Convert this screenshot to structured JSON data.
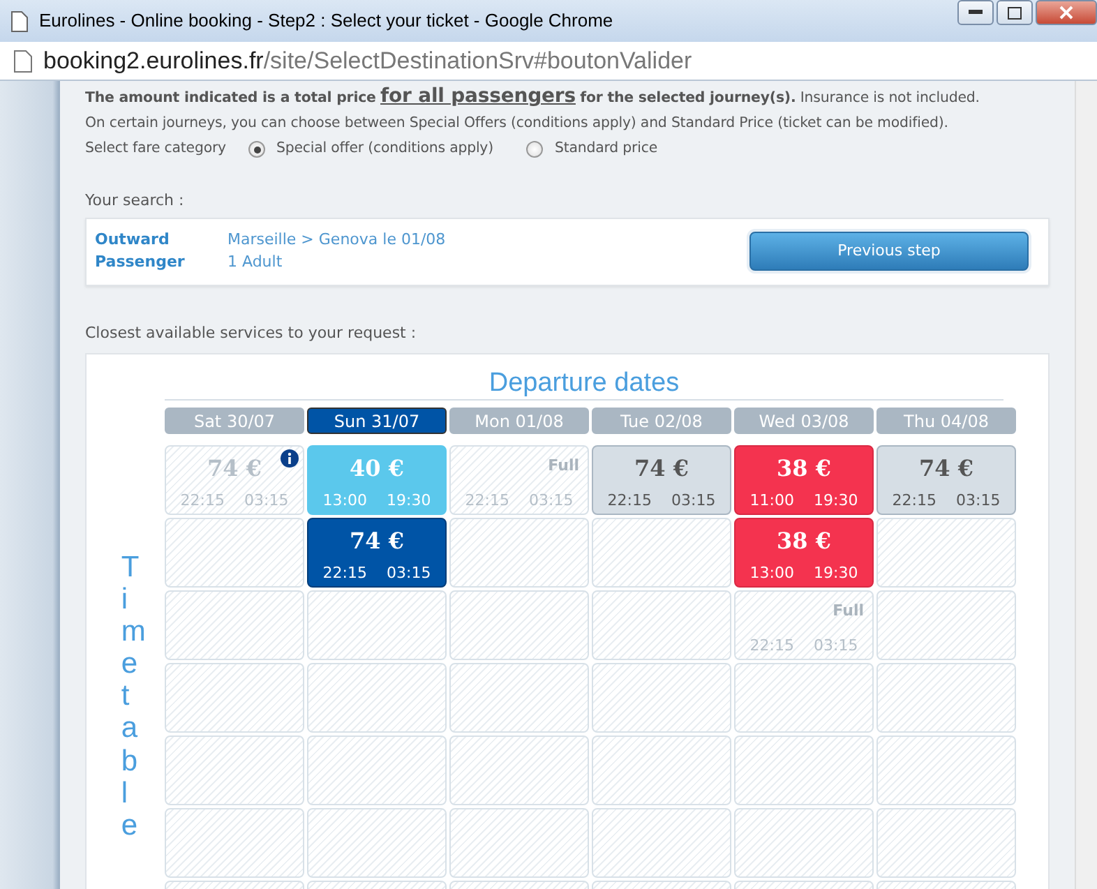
{
  "window": {
    "title": "Eurolines - Online booking - Step2 : Select your ticket - Google Chrome"
  },
  "address_bar": {
    "host": "booking2.eurolines.fr",
    "path": "/site/SelectDestinationSrv#boutonValider"
  },
  "notice": {
    "line_1": "**The amount indicated is a total price** for all passengers **for the selected journey(s).** Insurance is not included.",
    "line_2": "On certain journeys, you can choose between Special Offers (conditions apply) and Standard Price (ticket can be modified)."
  },
  "fare_category": {
    "label": "Select fare category",
    "options": [
      {
        "label": "Special offer (conditions apply)",
        "selected": true
      },
      {
        "label": "Standard price",
        "selected": false
      }
    ]
  },
  "search": {
    "heading": "Your search :",
    "rows": [
      {
        "label": "Outward",
        "value": "Marseille > Genova le 01/08"
      },
      {
        "label": "Passenger",
        "value": "1 Adult"
      }
    ],
    "button": "Previous step"
  },
  "results": {
    "heading": "Closest available services to your request :",
    "title": "Departure dates",
    "side_label": "Timetable",
    "days": [
      {
        "label": "Sat 30/07",
        "selected": false
      },
      {
        "label": "Sun 31/07",
        "selected": true
      },
      {
        "label": "Mon 01/08",
        "selected": false
      },
      {
        "label": "Tue 02/08",
        "selected": false
      },
      {
        "label": "Wed 03/08",
        "selected": false
      },
      {
        "label": "Thu 04/08",
        "selected": false
      }
    ],
    "rows": [
      [
        {
          "kind": "past",
          "price": "74 €",
          "depart": "22:15",
          "arrive": "03:15",
          "info": true
        },
        {
          "kind": "offer",
          "price": "40 €",
          "depart": "13:00",
          "arrive": "19:30"
        },
        {
          "kind": "full",
          "status": "Full",
          "depart": "22:15",
          "arrive": "03:15"
        },
        {
          "kind": "standard",
          "price": "74 €",
          "depart": "22:15",
          "arrive": "03:15"
        },
        {
          "kind": "cheap",
          "price": "38 €",
          "depart": "11:00",
          "arrive": "19:30"
        },
        {
          "kind": "standard",
          "price": "74 €",
          "depart": "22:15",
          "arrive": "03:15"
        }
      ],
      [
        {
          "kind": "empty"
        },
        {
          "kind": "selected",
          "price": "74 €",
          "depart": "22:15",
          "arrive": "03:15"
        },
        {
          "kind": "empty"
        },
        {
          "kind": "empty"
        },
        {
          "kind": "cheap",
          "price": "38 €",
          "depart": "13:00",
          "arrive": "19:30"
        },
        {
          "kind": "empty"
        }
      ],
      [
        {
          "kind": "empty"
        },
        {
          "kind": "empty"
        },
        {
          "kind": "empty"
        },
        {
          "kind": "empty"
        },
        {
          "kind": "full",
          "status": "Full",
          "depart": "22:15",
          "arrive": "03:15"
        },
        {
          "kind": "empty"
        }
      ],
      [
        {
          "kind": "empty"
        },
        {
          "kind": "empty"
        },
        {
          "kind": "empty"
        },
        {
          "kind": "empty"
        },
        {
          "kind": "empty"
        },
        {
          "kind": "empty"
        }
      ],
      [
        {
          "kind": "empty"
        },
        {
          "kind": "empty"
        },
        {
          "kind": "empty"
        },
        {
          "kind": "empty"
        },
        {
          "kind": "empty"
        },
        {
          "kind": "empty"
        }
      ],
      [
        {
          "kind": "empty"
        },
        {
          "kind": "empty"
        },
        {
          "kind": "empty"
        },
        {
          "kind": "empty"
        },
        {
          "kind": "empty"
        },
        {
          "kind": "empty"
        }
      ],
      [
        {
          "kind": "empty"
        },
        {
          "kind": "empty"
        },
        {
          "kind": "empty"
        },
        {
          "kind": "empty"
        },
        {
          "kind": "empty"
        },
        {
          "kind": "empty"
        }
      ]
    ]
  }
}
